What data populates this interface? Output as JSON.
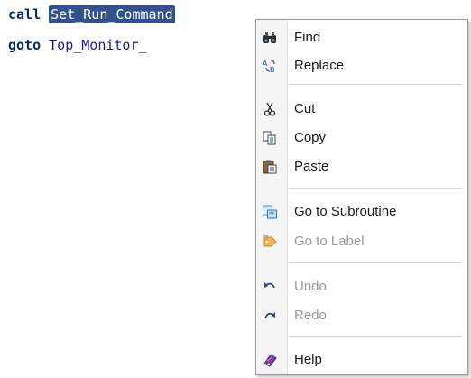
{
  "editor": {
    "line1": {
      "keyword": "call",
      "selected": "Set_Run_Command"
    },
    "line2": {
      "keyword": "goto",
      "arg": "Top_Monitor_"
    }
  },
  "context_menu": {
    "items": [
      {
        "label": "Find",
        "icon": "binoculars-icon",
        "enabled": true
      },
      {
        "label": "Replace",
        "icon": "replace-icon",
        "enabled": true
      },
      {
        "label": "Cut",
        "icon": "scissors-icon",
        "enabled": true
      },
      {
        "label": "Copy",
        "icon": "copy-icon",
        "enabled": true
      },
      {
        "label": "Paste",
        "icon": "paste-icon",
        "enabled": true
      },
      {
        "label": "Go to Subroutine",
        "icon": "subroutine-icon",
        "enabled": true
      },
      {
        "label": "Go to Label",
        "icon": "label-tag-icon",
        "enabled": false
      },
      {
        "label": "Undo",
        "icon": "undo-icon",
        "enabled": false
      },
      {
        "label": "Redo",
        "icon": "redo-icon",
        "enabled": false
      },
      {
        "label": "Help",
        "icon": "help-book-icon",
        "enabled": true
      }
    ]
  },
  "colors": {
    "selection": "#33528d",
    "code_text": "#1a1a8c",
    "disabled_text": "#9a9a9a"
  }
}
